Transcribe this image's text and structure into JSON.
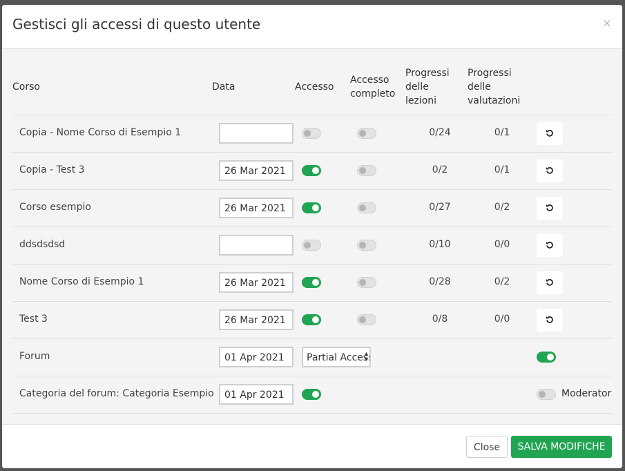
{
  "modal": {
    "title": "Gestisci gli accessi di questo utente",
    "close_icon": "×"
  },
  "table": {
    "headers": {
      "course": "Corso",
      "date": "Data",
      "access": "Accesso",
      "full_access": [
        "Accesso",
        "completo"
      ],
      "lesson_progress": [
        "Progressi",
        "delle",
        "lezioni"
      ],
      "assessment_progress": [
        "Progressi",
        "delle",
        "valutazioni"
      ]
    },
    "rows": [
      {
        "course": "Copia - Nome Corso di Esempio 1",
        "date": "",
        "access": false,
        "full": false,
        "lessons": "0/24",
        "assessments": "0/1"
      },
      {
        "course": "Copia - Test 3",
        "date": "26 Mar 2021",
        "access": true,
        "full": false,
        "lessons": "0/2",
        "assessments": "0/1"
      },
      {
        "course": "Corso esempio",
        "date": "26 Mar 2021",
        "access": true,
        "full": false,
        "lessons": "0/27",
        "assessments": "0/2"
      },
      {
        "course": "ddsdsdsd",
        "date": "",
        "access": false,
        "full": false,
        "lessons": "0/10",
        "assessments": "0/0"
      },
      {
        "course": "Nome Corso di Esempio 1",
        "date": "26 Mar 2021",
        "access": true,
        "full": false,
        "lessons": "0/28",
        "assessments": "0/2"
      },
      {
        "course": "Test 3",
        "date": "26 Mar 2021",
        "access": true,
        "full": false,
        "lessons": "0/8",
        "assessments": "0/0"
      }
    ],
    "forum_row": {
      "course": "Forum",
      "date": "01 Apr 2021",
      "access_select": "Partial Access",
      "enabled": true
    },
    "category_row": {
      "course": "Categoria del forum: Categoria Esempio",
      "date": "01 Apr 2021",
      "access": true,
      "moderator": false,
      "moderator_label": "Moderator"
    }
  },
  "footer": {
    "close_label": "Close",
    "save_label": "SALVA MODIFICHE"
  },
  "colors": {
    "accent": "#22a552",
    "toggle_off": "#e2e2e2"
  },
  "icons": {
    "reset": "reset-icon",
    "close": "close-icon"
  }
}
